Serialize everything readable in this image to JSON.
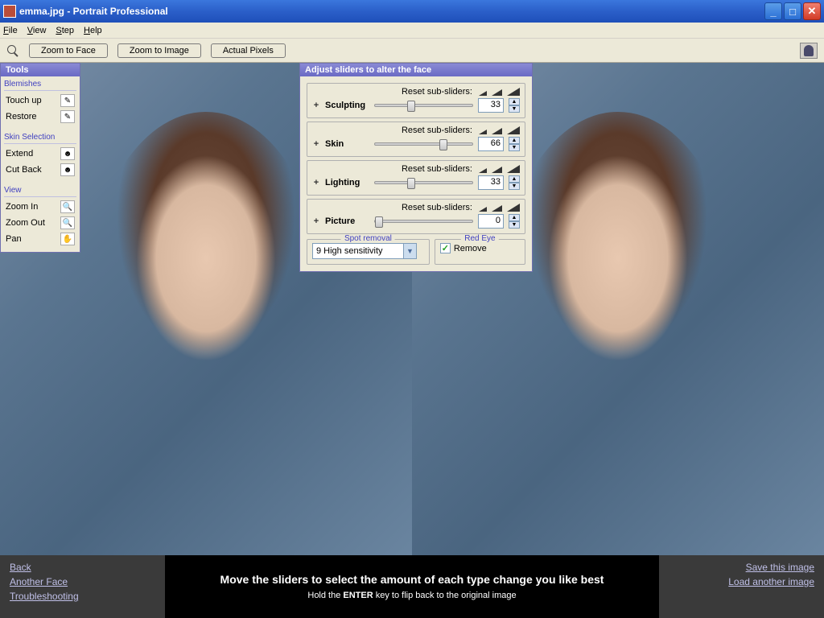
{
  "window": {
    "title": "emma.jpg - Portrait Professional"
  },
  "menu": {
    "file": "File",
    "view": "View",
    "step": "Step",
    "help": "Help"
  },
  "toolbar": {
    "zoom_face": "Zoom to Face",
    "zoom_image": "Zoom to Image",
    "actual_pixels": "Actual Pixels"
  },
  "tools": {
    "title": "Tools",
    "blemishes": {
      "label": "Blemishes",
      "touchup": "Touch up",
      "restore": "Restore"
    },
    "skin": {
      "label": "Skin Selection",
      "extend": "Extend",
      "cutback": "Cut Back"
    },
    "view": {
      "label": "View",
      "zoomin": "Zoom In",
      "zoomout": "Zoom Out",
      "pan": "Pan"
    }
  },
  "sliders": {
    "title": "Adjust sliders to alter the face",
    "reset": "Reset sub-sliders:",
    "items": [
      {
        "name": "Sculpting",
        "value": "33",
        "pos": 33
      },
      {
        "name": "Skin",
        "value": "66",
        "pos": 66
      },
      {
        "name": "Lighting",
        "value": "33",
        "pos": 33
      },
      {
        "name": "Picture",
        "value": "0",
        "pos": 0
      }
    ],
    "spot": {
      "label": "Spot removal",
      "value": "9 High sensitivity"
    },
    "redeye": {
      "label": "Red Eye",
      "remove": "Remove"
    }
  },
  "footer": {
    "back": "Back",
    "another": "Another Face",
    "trouble": "Troubleshooting",
    "line1": "Move the sliders to select the amount of each type change you like best",
    "line2a": "Hold the ",
    "line2b": "ENTER",
    "line2c": " key to flip back to the original image",
    "save": "Save this image",
    "load": "Load another image"
  }
}
